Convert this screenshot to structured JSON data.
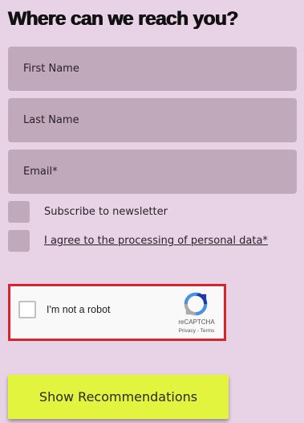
{
  "form": {
    "title": "Where can we reach you?",
    "fields": {
      "first_name_placeholder": "First Name",
      "last_name_placeholder": "Last Name",
      "email_placeholder": "Email*"
    },
    "checkboxes": {
      "subscribe_label": "Subscribe to newsletter",
      "agree_label": "I agree to the processing of personal data*"
    },
    "recaptcha": {
      "label": "I'm not a robot",
      "brand": "reCAPTCHA",
      "privacy": "Privacy",
      "separator": " - ",
      "terms": "Terms"
    },
    "submit_label": "Show Recommendations"
  },
  "colors": {
    "background": "#e8d3e6",
    "field": "#c0a9ba",
    "recaptcha_highlight": "#d9242b",
    "button": "#e2f43d"
  }
}
